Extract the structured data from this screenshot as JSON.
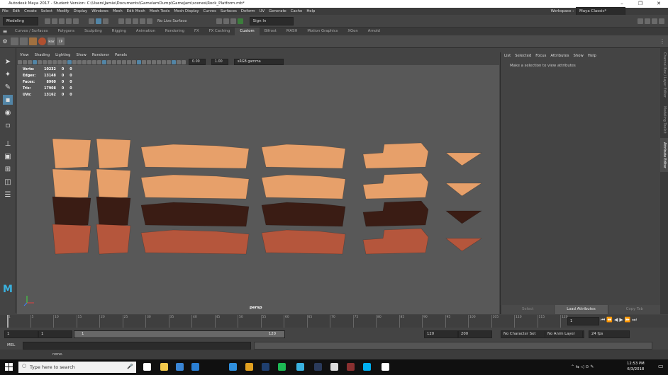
{
  "title": "Autodesk Maya 2017 - Student Version: C:\\Users\\Jamie\\Documents\\GamelamDump\\GameJam\\scenes\\Rock_Platform.mb*",
  "menus": [
    "File",
    "Edit",
    "Create",
    "Select",
    "Modify",
    "Display",
    "Windows",
    "Mesh",
    "Edit Mesh",
    "Mesh Tools",
    "Mesh Display",
    "Curves",
    "Surfaces",
    "Deform",
    "UV",
    "Generate",
    "Cache",
    "Help"
  ],
  "workspace_label": "Workspace :",
  "workspace_value": "Maya Classic*",
  "mode": "Modeling",
  "live_surface": "No Live Surface",
  "sign_in": "Sign In",
  "shelf_tabs": [
    "Curves / Surfaces",
    "Polygons",
    "Sculpting",
    "Rigging",
    "Animation",
    "Rendering",
    "FX",
    "FX Caching",
    "Custom",
    "Bifrost",
    "MASH",
    "Motion Graphics",
    "XGen",
    "Arnold"
  ],
  "active_shelf_tab": "Custom",
  "shelf_icons": [
    "Hair",
    "CP"
  ],
  "viewport_menus": [
    "View",
    "Shading",
    "Lighting",
    "Show",
    "Renderer",
    "Panels"
  ],
  "viewport_values": {
    "exposure": "0.00",
    "gamma": "1.00",
    "color_space": "sRGB gamma"
  },
  "hud": [
    {
      "label": "Verts:",
      "v1": "10232",
      "v2": "0",
      "v3": "0"
    },
    {
      "label": "Edges:",
      "v1": "13148",
      "v2": "0",
      "v3": "0"
    },
    {
      "label": "Faces:",
      "v1": "8960",
      "v2": "0",
      "v3": "0"
    },
    {
      "label": "Tris:",
      "v1": "17908",
      "v2": "0",
      "v3": "0"
    },
    {
      "label": "UVs:",
      "v1": "13162",
      "v2": "0",
      "v3": "0"
    }
  ],
  "camera": "persp",
  "right_menus": [
    "List",
    "Selected",
    "Focus",
    "Attributes",
    "Show",
    "Help"
  ],
  "attr_message": "Make a selection to view attributes",
  "rp_buttons": [
    "Select",
    "Load Attributes",
    "Copy Tab"
  ],
  "side_tabs": [
    "Channel Box / Layer Editor",
    "Modeling Toolkit",
    "Attribute Editor"
  ],
  "timeline_ticks": [
    "1",
    "5",
    "10",
    "15",
    "20",
    "25",
    "30",
    "35",
    "40",
    "45",
    "50",
    "55",
    "60",
    "65",
    "70",
    "75",
    "80",
    "85",
    "90",
    "95",
    "100",
    "105",
    "110",
    "115",
    "120"
  ],
  "current_frame": "1",
  "range": {
    "start": "1",
    "inner_start": "1",
    "inner_end": "120",
    "end": "120",
    "anim_end": "200"
  },
  "character_set": "No Character Set",
  "anim_layer": "No Anim Layer",
  "fps": "24 fps",
  "cmd_lang": "MEL",
  "help_text": "none.",
  "taskbar": {
    "search": "Type here to search",
    "time": "12:53 PM",
    "date": "6/3/2018"
  },
  "colors": {
    "accent": "#5285a6",
    "rock_light": "#e7a06a",
    "rock_dark": "#3a1c14",
    "rock_red": "#b5563c"
  }
}
